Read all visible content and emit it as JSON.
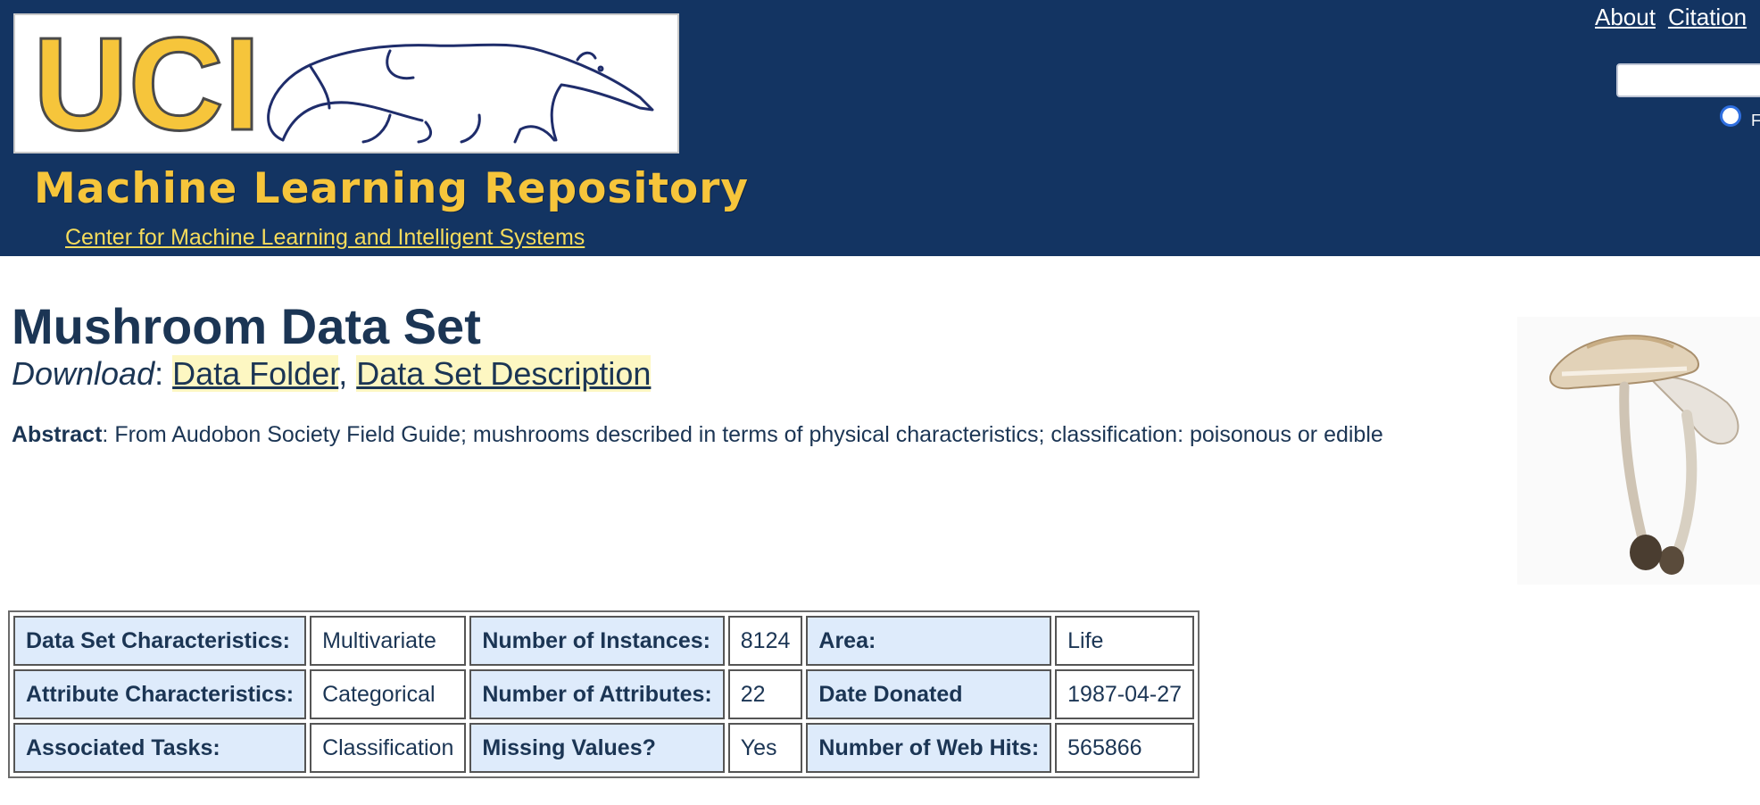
{
  "header": {
    "logo_text": "UCI",
    "repo_title": "Machine Learning Repository",
    "center_link": "Center for Machine Learning and Intelligent Systems",
    "nav": [
      "About",
      "Citation"
    ],
    "search": {
      "value": "",
      "placeholder": ""
    },
    "radio_label": "F"
  },
  "dataset": {
    "title": "Mushroom Data Set",
    "download_label": "Download",
    "download_links": [
      "Data Folder",
      "Data Set Description"
    ],
    "abstract_label": "Abstract",
    "abstract_text": ": From Audobon Society Field Guide; mushrooms described in terms of physical characteristics; classification: poisonous or edible"
  },
  "stats": [
    [
      {
        "key": "Data Set Characteristics:",
        "value": "Multivariate"
      },
      {
        "key": "Number of Instances:",
        "value": "8124"
      },
      {
        "key": "Area:",
        "value": "Life"
      }
    ],
    [
      {
        "key": "Attribute Characteristics:",
        "value": "Categorical"
      },
      {
        "key": "Number of Attributes:",
        "value": "22"
      },
      {
        "key": "Date Donated",
        "value": "1987-04-27"
      }
    ],
    [
      {
        "key": "Associated Tasks:",
        "value": "Classification"
      },
      {
        "key": "Missing Values?",
        "value": "Yes"
      },
      {
        "key": "Number of Web Hits:",
        "value": "565866"
      }
    ]
  ],
  "colors": {
    "header_bg": "#133462",
    "logo_yellow": "#f6c53b",
    "key_cell_bg": "#deebfb",
    "link_highlight": "#fdf7c2",
    "text": "#1b3554"
  }
}
